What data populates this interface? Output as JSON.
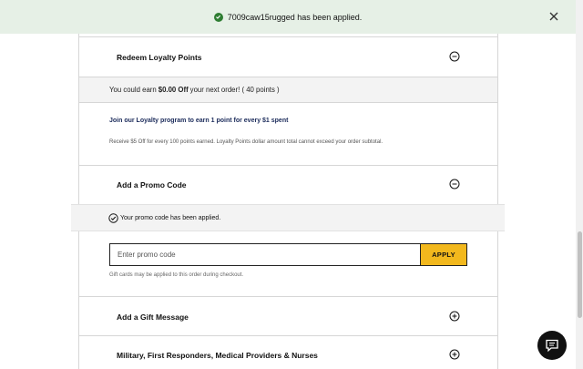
{
  "toast": {
    "message": "7009caw15rugged has been applied.",
    "close_icon": "close-icon",
    "check_icon": "check-circle-icon"
  },
  "loyalty": {
    "title": "Redeem Loyalty Points",
    "earn_prefix": "You could earn",
    "earn_amount": "$0.00 Off",
    "earn_suffix": "your next order! ( 40 points )",
    "join_text": "Join our Loyalty program to earn 1 point for every $1 spent",
    "receive_text": "Receive $5 Off for every 100 points earned. Loyalty Points dollar amount total cannot exceed your order subtotal.",
    "toggle_icon": "minus-circle-icon"
  },
  "promo": {
    "title": "Add a Promo Code",
    "applied_text": "Your promo code has been applied.",
    "input_placeholder": "Enter promo code",
    "apply_label": "APPLY",
    "gift_note": "Gift cards may be applied to this order during checkout.",
    "toggle_icon": "minus-circle-icon"
  },
  "gift_message": {
    "title": "Add a Gift Message",
    "toggle_icon": "plus-circle-icon"
  },
  "military": {
    "title": "Military, First Responders, Medical Providers & Nurses",
    "toggle_icon": "plus-circle-icon"
  },
  "colors": {
    "toast_bg": "#e6f0e6",
    "success": "#2e7d32",
    "apply_button": "#f2b81d",
    "chat_button": "#111111"
  }
}
